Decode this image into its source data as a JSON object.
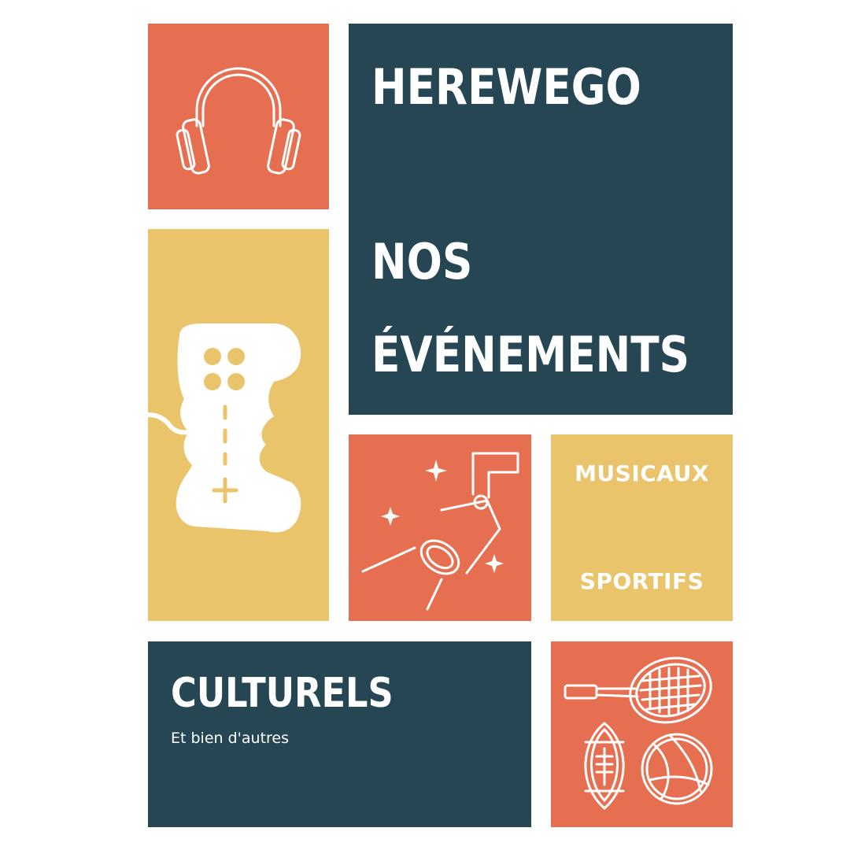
{
  "brand": "HEREWEGO",
  "heading": {
    "line1": "NOS",
    "line2": "ÉVÉNEMENTS"
  },
  "categories": {
    "musicaux": "MUSICAUX",
    "sportifs": "SPORTIFS",
    "culturels": "CULTURELS"
  },
  "subtitle": "Et bien d'autres",
  "colors": {
    "orange": "#e76f51",
    "yellow": "#e9c46a",
    "navy": "#264653",
    "white": "#ffffff"
  },
  "icons": [
    "headphones-icon",
    "game-controller-icon",
    "spotlight-icon",
    "tennis-racket-icon",
    "football-icon",
    "basketball-icon"
  ]
}
